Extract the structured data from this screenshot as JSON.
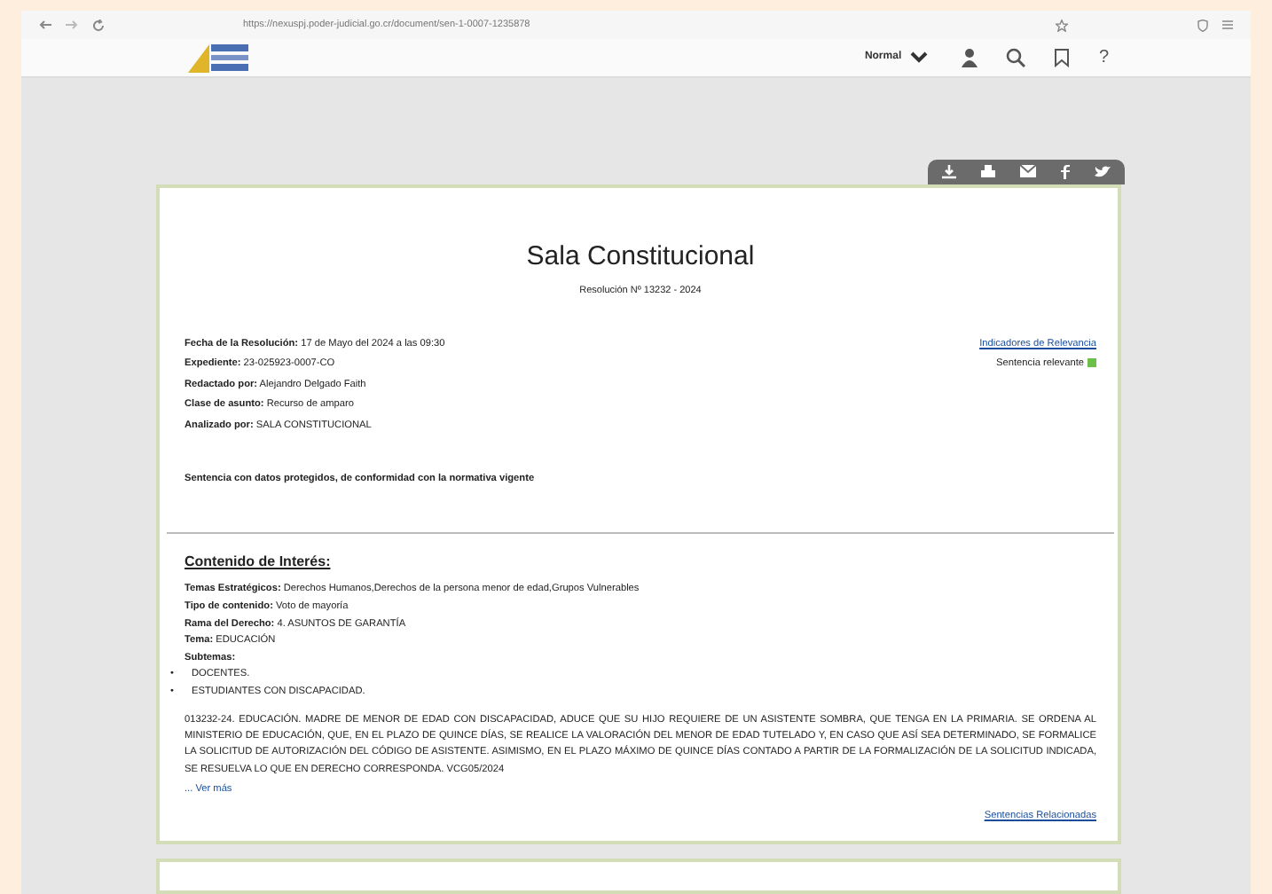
{
  "browser": {
    "url": "https://nexuspj.poder-judicial.go.cr/document/sen-1-0007-1235878"
  },
  "header": {
    "view_select": "Normal",
    "help": "?"
  },
  "document": {
    "title": "Sala Constitucional",
    "subtitle": "Resolución Nº 13232 - 2024",
    "fields": [
      {
        "label": "Fecha de la Resolución:",
        "value": "17 de Mayo del 2024 a las 09:30"
      },
      {
        "label": "Expediente:",
        "value": "23-025923-0007-CO"
      },
      {
        "label": "Redactado por:",
        "value": "Alejandro Delgado Faith"
      },
      {
        "label": "Clase de asunto:",
        "value": "Recurso de amparo"
      },
      {
        "label": "Analizado por:",
        "value": "SALA CONSTITUCIONAL"
      }
    ],
    "relevance_link": "Indicadores de Relevancia",
    "relevance": {
      "label": "Sentencia relevante",
      "color": "#6cc04a"
    },
    "notice": "Sentencia con datos protegidos, de conformidad con la normativa vigente"
  },
  "content": {
    "heading": "Contenido de Interés:",
    "fields": [
      {
        "label": "Temas Estratégicos:",
        "value": "Derechos Humanos,Derechos de la persona menor de edad,Grupos Vulnerables"
      },
      {
        "label": "Tipo de contenido:",
        "value": "Voto de mayoría"
      },
      {
        "label": "Rama del Derecho:",
        "value": "4. ASUNTOS DE GARANTÍA"
      },
      {
        "label": "Tema:",
        "value": "EDUCACIÓN"
      },
      {
        "label": "Subtemas:"
      }
    ],
    "subtopics": [
      {
        "marker": "•",
        "text": "DOCENTES."
      },
      {
        "marker": "•",
        "text": "ESTUDIANTES CON DISCAPACIDAD."
      }
    ],
    "summary": "013232-24. EDUCACIÓN. MADRE DE MENOR DE EDAD CON DISCAPACIDAD, ADUCE QUE SU HIJO REQUIERE DE UN ASISTENTE SOMBRA, QUE TENGA EN LA PRIMARIA. SE ORDENA AL MINISTERIO DE EDUCACIÓN, QUE, EN EL PLAZO DE QUINCE DÍAS, SE REALICE LA VALORACIÓN DEL MENOR DE EDAD TUTELADO Y, EN CASO QUE ASÍ SEA DETERMINADO, SE FORMALICE LA SOLICITUD DE AUTORIZACIÓN DEL CÓDIGO DE ASISTENTE. ASIMISMO, EN EL PLAZO MÁXIMO DE QUINCE DÍAS CONTADO A PARTIR DE LA FORMALIZACIÓN DE LA SOLICITUD INDICADA, SE RESUELVA LO QUE EN DERECHO CORRESPONDA. VCG05/2024",
    "more_link": "... Ver más",
    "related_link": "Sentencias Relacionadas"
  }
}
